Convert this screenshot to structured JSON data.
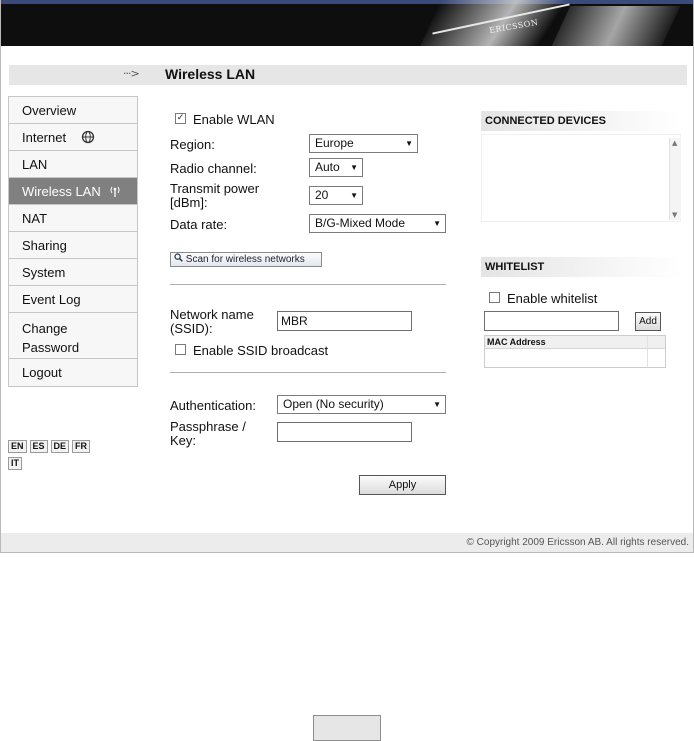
{
  "header": {
    "brand": "ERICSSON"
  },
  "titlebar": {
    "arrow": "···>",
    "title": "Wireless LAN"
  },
  "sidebar": {
    "items": [
      {
        "label": "Overview"
      },
      {
        "label": "Internet",
        "icon": "globe-icon"
      },
      {
        "label": "LAN"
      },
      {
        "label": "Wireless LAN",
        "icon": "wireless-icon",
        "active": true
      },
      {
        "label": "NAT"
      },
      {
        "label": "Sharing"
      },
      {
        "label": "System"
      },
      {
        "label": "Event Log"
      },
      {
        "label": "Change",
        "label2": "Password"
      },
      {
        "label": "Logout"
      }
    ]
  },
  "languages": [
    "EN",
    "ES",
    "DE",
    "FR",
    "IT"
  ],
  "form": {
    "enable_wlan": {
      "label": "Enable WLAN",
      "checked": true,
      "mark": "✓"
    },
    "region": {
      "label": "Region:",
      "value": "Europe"
    },
    "channel": {
      "label": "Radio channel:",
      "value": "Auto"
    },
    "power": {
      "label_line1": "Transmit power",
      "label_line2": "[dBm]:",
      "value": "20"
    },
    "rate": {
      "label": "Data rate:",
      "value": "B/G-Mixed Mode"
    },
    "scan_button": "Scan for wireless networks",
    "ssid": {
      "label_line1": "Network name",
      "label_line2": "(SSID):",
      "value": "MBR"
    },
    "ssid_broadcast": {
      "label": "Enable SSID broadcast",
      "checked": false
    },
    "auth": {
      "label": "Authentication:",
      "value": "Open (No security)"
    },
    "passphrase": {
      "label_line1": "Passphrase /",
      "label_line2": "Key:",
      "value": ""
    },
    "apply": "Apply"
  },
  "connected": {
    "title": "CONNECTED DEVICES"
  },
  "whitelist": {
    "title": "WHITELIST",
    "enable_label": "Enable whitelist",
    "enable_checked": false,
    "mac_value": "",
    "add": "Add",
    "column": "MAC Address"
  },
  "footer": {
    "copyright": "© Copyright 2009 Ericsson AB. All rights reserved."
  },
  "colors": {
    "active_nav": "#808080",
    "header_bg": "#0e0e0e",
    "titlebar_bg": "#e6e6e6"
  }
}
